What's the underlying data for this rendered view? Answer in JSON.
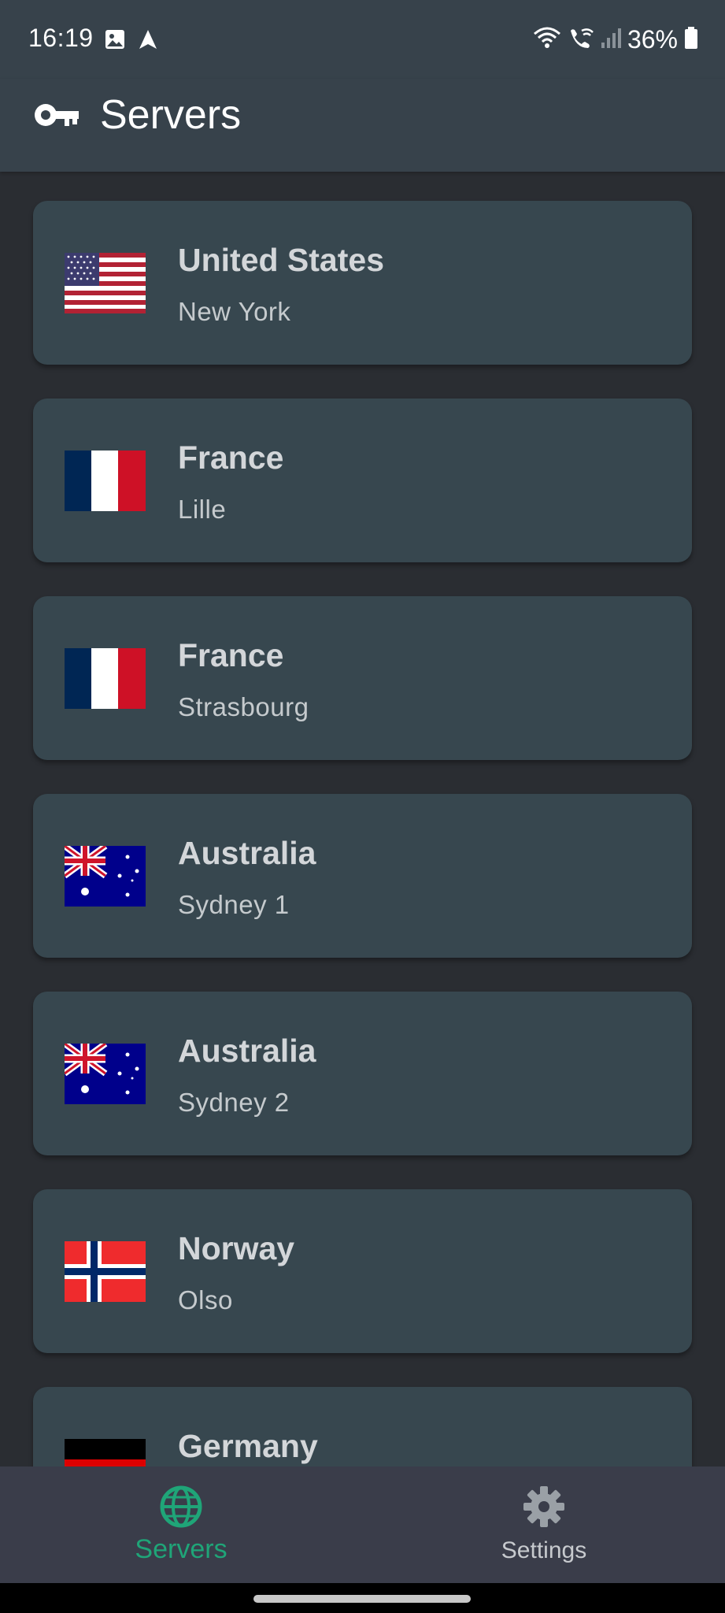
{
  "status_bar": {
    "time": "16:19",
    "battery": "36%",
    "left_icons": [
      "image-icon",
      "navigation-arrow-icon"
    ],
    "right_icons": [
      "wifi-calling-icon",
      "wifi-call-icon",
      "signal-icon",
      "battery-icon"
    ]
  },
  "app_bar": {
    "title": "Servers",
    "icon": "key-icon"
  },
  "servers": [
    {
      "country": "United States",
      "city": "New York",
      "flag": "us-flag-icon"
    },
    {
      "country": "France",
      "city": "Lille",
      "flag": "fr-flag-icon"
    },
    {
      "country": "France",
      "city": "Strasbourg",
      "flag": "fr-flag-icon"
    },
    {
      "country": "Australia",
      "city": "Sydney 1",
      "flag": "au-flag-icon"
    },
    {
      "country": "Australia",
      "city": "Sydney 2",
      "flag": "au-flag-icon"
    },
    {
      "country": "Norway",
      "city": "Olso",
      "flag": "no-flag-icon"
    },
    {
      "country": "Germany",
      "city": "",
      "flag": "de-flag-icon"
    }
  ],
  "bottom_nav": {
    "servers_label": "Servers",
    "settings_label": "Settings",
    "active": "servers"
  },
  "colors": {
    "accent": "#1fa578",
    "card_bg": "#37474f",
    "app_bar_bg": "#37424b",
    "page_bg": "#2a2d32",
    "nav_bg": "#3a3d4a"
  }
}
